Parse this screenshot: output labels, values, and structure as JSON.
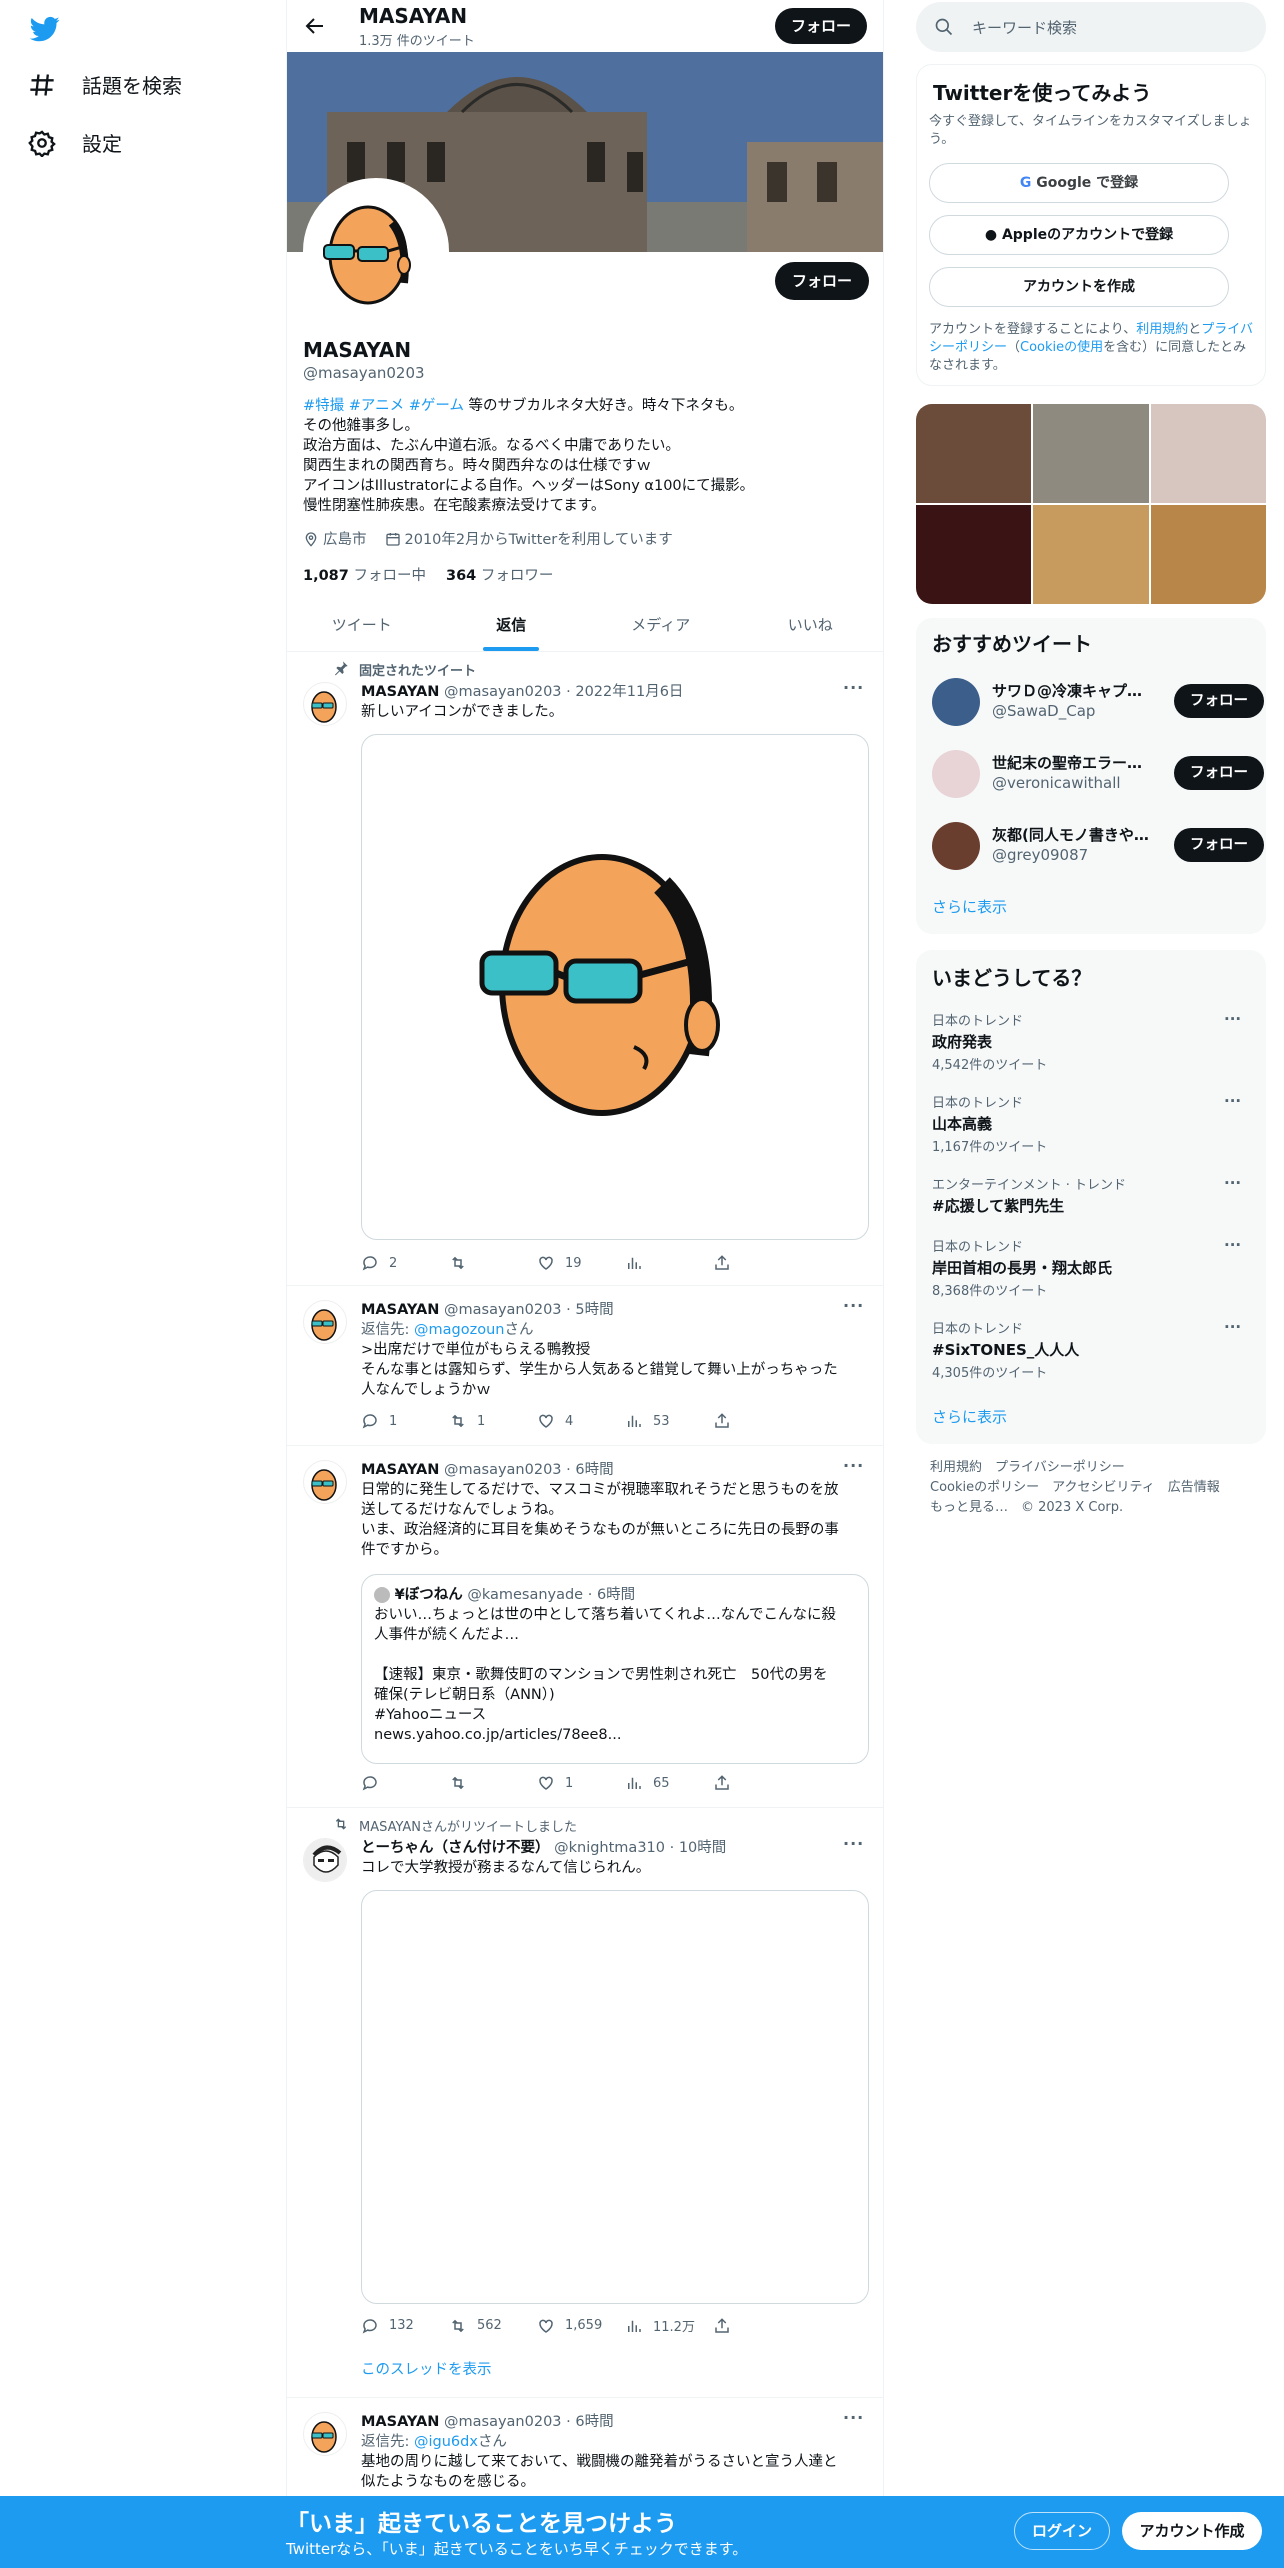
{
  "nav": {
    "explore_label": "話題を検索",
    "settings_label": "設定"
  },
  "header": {
    "name": "MASAYAN",
    "tweet_count": "1.3万 件のツイート",
    "follow_label": "フォロー"
  },
  "profile": {
    "name": "MASAYAN",
    "handle": "@masayan0203",
    "follow_label": "フォロー",
    "bio_tags": [
      "#特撮",
      "#アニメ",
      "#ゲーム"
    ],
    "bio_line1_rest": " 等のサブカルネタ大好き。時々下ネタも。",
    "bio_lines": [
      "その他雑事多し。",
      "政治方面は、たぶん中道右派。なるべく中庸でありたい。",
      "関西生まれの関西育ち。時々関西弁なのは仕様ですｗ",
      "アイコンはIllustratorによる自作。ヘッダーはSony α100にて撮影。",
      "慢性閉塞性肺疾患。在宅酸素療法受けてます。"
    ],
    "location": "広島市",
    "joined": "2010年2月からTwitterを利用しています",
    "following_count": "1,087",
    "following_label": "フォロー中",
    "followers_count": "364",
    "followers_label": "フォロワー"
  },
  "tabs": [
    "ツイート",
    "返信",
    "メディア",
    "いいね"
  ],
  "tweets": [
    {
      "context": "固定されたツイート",
      "name": "MASAYAN",
      "handle": "@masayan0203",
      "time": "2022年11月6日",
      "text": "新しいアイコンができました。",
      "replies": "2",
      "retweets": "",
      "likes": "19",
      "views": ""
    },
    {
      "name": "MASAYAN",
      "handle": "@masayan0203",
      "time": "5時間",
      "reply_prefix": "返信先: ",
      "reply_to": "@magozoun",
      "reply_suffix": "さん",
      "text_lines": [
        ">出席だけで単位がもらえる鴨教授",
        "そんな事とは露知らず、学生から人気あると錯覚して舞い上がっちゃった",
        "人なんでしょうかｗ"
      ],
      "replies": "1",
      "retweets": "1",
      "likes": "4",
      "views": "53"
    },
    {
      "name": "MASAYAN",
      "handle": "@masayan0203",
      "time": "6時間",
      "text_lines": [
        "日常的に発生してるだけで、マスコミが視聴率取れそうだと思うものを放",
        "送してるだけなんでしょうね。",
        "いま、政治経済的に耳目を集めそうなものが無いところに先日の長野の事",
        "件ですから。"
      ],
      "quote": {
        "name": "¥ぼつねん",
        "handle": "@kamesanyade",
        "time": "6時間",
        "lines": [
          "おいい…ちょっとは世の中として落ち着いてくれよ…なんでこんなに殺",
          "人事件が続くんだよ…",
          "",
          "【速報】東京・歌舞伎町のマンションで男性刺され死亡　50代の男を",
          "確保(テレビ朝日系（ANN）)",
          "#Yahooニュース",
          "news.yahoo.co.jp/articles/78ee8..."
        ]
      },
      "replies": "",
      "retweets": "",
      "likes": "1",
      "views": "65"
    },
    {
      "context": "MASAYANさんがリツイートしました",
      "name": "とーちゃん（さん付け不要）",
      "handle": "@knightma310",
      "time": "10時間",
      "text": "コレで大学教授が務まるなんて信じられん。",
      "replies": "132",
      "retweets": "562",
      "likes": "1,659",
      "views": "11.2万",
      "thread_link": "このスレッドを表示"
    },
    {
      "name": "MASAYAN",
      "handle": "@masayan0203",
      "time": "6時間",
      "reply_prefix": "返信先: ",
      "reply_to": "@igu6dx",
      "reply_suffix": "さん",
      "text_lines": [
        "基地の周りに越して来ておいて、戦闘機の離発着がうるさいと宣う人達と",
        "似たようなものを感じる。"
      ]
    }
  ],
  "search": {
    "placeholder": "キーワード検索"
  },
  "signup": {
    "title": "Twitterを使ってみよう",
    "subtitle": "今すぐ登録して、タイムラインをカスタマイズしましょう。",
    "google_label": "Google で登録",
    "apple_label": "Appleのアカウントで登録",
    "create_label": "アカウントを作成",
    "legal_1": "アカウントを登録することにより、",
    "legal_terms": "利用規約",
    "legal_2": "と",
    "legal_privacy": "プライバシーポリシー",
    "legal_3": "（",
    "legal_cookie": "Cookieの使用",
    "legal_4": "を含む）に同意したとみなされます。"
  },
  "recommend": {
    "title": "おすすめツイート",
    "users": [
      {
        "name": "サワＤ@冷凍キャプ…",
        "handle": "@SawaD_Cap",
        "follow": "フォロー"
      },
      {
        "name": "世紀末の聖帝エラー…",
        "handle": "@veronicawithall",
        "follow": "フォロー"
      },
      {
        "name": "灰都(同人モノ書きや…",
        "handle": "@grey09087",
        "follow": "フォロー"
      }
    ],
    "more": "さらに表示"
  },
  "trends": {
    "title": "いまどうしてる？",
    "items": [
      {
        "category": "日本のトレンド",
        "name": "政府発表",
        "count": "4,542件のツイート"
      },
      {
        "category": "日本のトレンド",
        "name": "山本高義",
        "count": "1,167件のツイート"
      },
      {
        "category": "エンターテインメント · トレンド",
        "name": "#応援して紫門先生",
        "count": ""
      },
      {
        "category": "日本のトレンド",
        "name": "岸田首相の長男・翔太郎氏",
        "count": "8,368件のツイート"
      },
      {
        "category": "日本のトレンド",
        "name": "#SixTONES_人人人",
        "count": "4,305件のツイート"
      }
    ],
    "more": "さらに表示"
  },
  "footer": {
    "line1": "利用規約　プライバシーポリシー",
    "line2": "Cookieのポリシー　アクセシビリティ　広告情報",
    "line3": "もっと見る…　© 2023 X Corp."
  },
  "bottombar": {
    "title": "「いま」起きていることを見つけよう",
    "subtitle": "Twitterなら、「いま」起きていることをいち早くチェックできます。",
    "login": "ログイン",
    "signup": "アカウント作成"
  },
  "colors": {
    "accent": "#1d9bf0",
    "text": "#0f1419",
    "muted": "#536471"
  }
}
